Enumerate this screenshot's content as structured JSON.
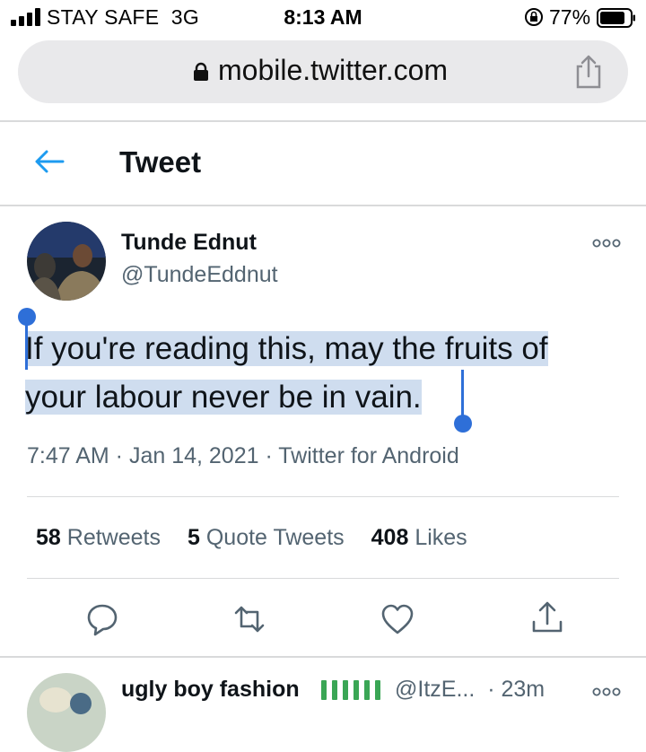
{
  "status_bar": {
    "carrier": "STAY SAFE  3G",
    "time": "8:13 AM",
    "battery": "77%"
  },
  "browser": {
    "url": "mobile.twitter.com"
  },
  "header": {
    "title": "Tweet"
  },
  "tweet": {
    "author_name": "Tunde Ednut",
    "author_handle": "@TundeEddnut",
    "text_line1": "If you're reading this, may the fruits of",
    "text_line2": "your labour never be in vain.",
    "meta": "7:47 AM · Jan 14, 2021 · Twitter for Android",
    "stats": {
      "retweets_count": "58",
      "retweets_label": "Retweets",
      "quote_count": "5",
      "quote_label": "Quote Tweets",
      "likes_count": "408",
      "likes_label": "Likes"
    },
    "actions": [
      "reply-icon",
      "retweet-icon",
      "like-icon",
      "share-icon"
    ]
  },
  "reply": {
    "name": "ugly boy fashion",
    "handle": "@ItzE...",
    "time": "· 23m"
  },
  "colors": {
    "accent": "#1d9bf0",
    "selection": "#cfddef",
    "selection_handle": "#2e6fd8",
    "secondary_text": "#536471",
    "flag_green": "#3aa655"
  }
}
